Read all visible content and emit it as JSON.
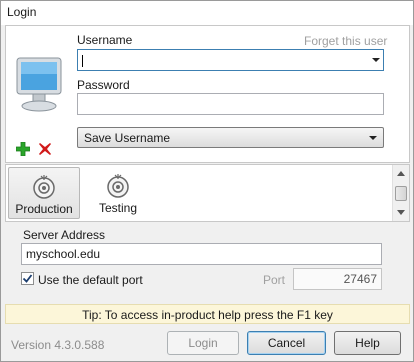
{
  "window": {
    "title": "Login"
  },
  "login": {
    "username_label": "Username",
    "forget_label": "Forget this user",
    "username_value": "",
    "password_label": "Password",
    "password_value": "",
    "save_option": "Save Username"
  },
  "servers": {
    "items": [
      {
        "label": "Production",
        "selected": true
      },
      {
        "label": "Testing",
        "selected": false
      }
    ]
  },
  "server": {
    "address_label": "Server Address",
    "address_value": "myschool.edu",
    "default_port_label": "Use the default port",
    "default_port_checked": true,
    "port_label": "Port",
    "port_value": "27467"
  },
  "tip": "Tip: To access in-product help press the F1 key",
  "footer": {
    "version": "Version 4.3.0.588",
    "login_label": "Login",
    "cancel_label": "Cancel",
    "help_label": "Help"
  },
  "icons": {
    "computer": "computer-icon",
    "add": "add-icon",
    "remove": "remove-icon",
    "server": "server-icon",
    "checkmark": "checkmark-icon",
    "dropdown": "chevron-down-icon"
  },
  "colors": {
    "add_green": "#2aa52a",
    "remove_red": "#d11a1a",
    "tip_background": "#fcf6d9"
  }
}
